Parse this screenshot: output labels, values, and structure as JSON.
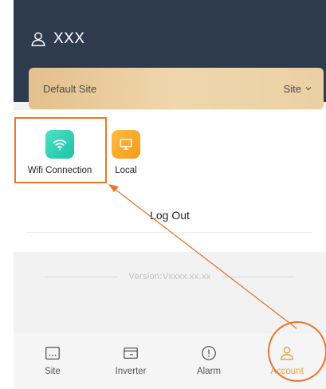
{
  "user": {
    "icon": "user-icon",
    "name": "XXX"
  },
  "site_card": {
    "name": "Default Site",
    "switch_label": "Site",
    "chevron_icon": "chevron-down-icon"
  },
  "apps": [
    {
      "label": "Wifi Connection",
      "icon": "wifi-icon",
      "color": "#1cc3a8"
    },
    {
      "label": "Local",
      "icon": "monitor-icon",
      "color": "#f59b17"
    }
  ],
  "logout_label": "Log Out",
  "version_text": "Version:Vxxxx.xx.xx",
  "tabs": [
    {
      "label": "Site",
      "icon": "site-icon",
      "active": false
    },
    {
      "label": "Inverter",
      "icon": "inverter-icon",
      "active": false
    },
    {
      "label": "Alarm",
      "icon": "alarm-icon",
      "active": false
    },
    {
      "label": "Account",
      "icon": "account-icon",
      "active": true
    }
  ],
  "colors": {
    "header": "#2e3a4d",
    "accent": "#e8a33d",
    "annotation": "#e8762c"
  }
}
